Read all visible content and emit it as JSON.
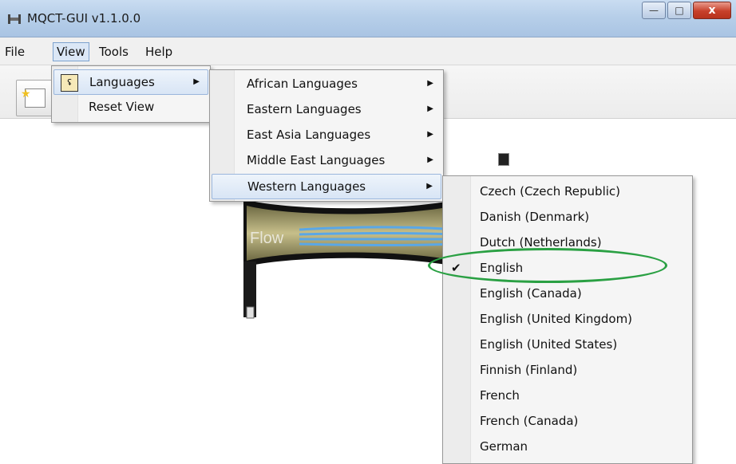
{
  "window": {
    "title": "MQCT-GUI v1.1.0.0",
    "controls": {
      "minimize": "—",
      "maximize": "□",
      "close": "x"
    }
  },
  "menubar": {
    "file": "File",
    "view": "View",
    "tools": "Tools",
    "help": "Help"
  },
  "view_menu": {
    "items": [
      {
        "label": "Languages",
        "has_submenu": true
      },
      {
        "label": "Reset View",
        "has_submenu": false
      }
    ]
  },
  "languages_menu": {
    "items": [
      {
        "label": "African Languages"
      },
      {
        "label": "Eastern Languages"
      },
      {
        "label": "East Asia Languages"
      },
      {
        "label": "Middle East Languages"
      },
      {
        "label": "Western Languages"
      }
    ]
  },
  "western_menu": {
    "items": [
      "Czech (Czech Republic)",
      "Danish (Denmark)",
      "Dutch (Netherlands)",
      "English",
      "English (Canada)",
      "English (United Kingdom)",
      "English (United States)",
      "Finnish (Finland)",
      "French",
      "French (Canada)",
      "German"
    ],
    "checked": "English"
  },
  "graphic": {
    "flow_label": "Flow"
  },
  "colors": {
    "highlight_border": "#9ab6dc",
    "annotation_ellipse": "#2aa043",
    "flow_lines": "#5aa7e6"
  }
}
